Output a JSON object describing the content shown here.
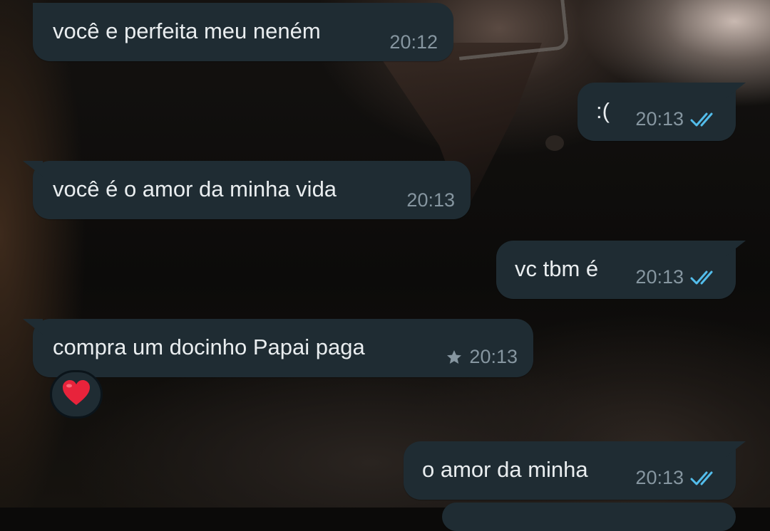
{
  "chat": {
    "messages": [
      {
        "direction": "incoming",
        "text": "você e perfeita meu neném",
        "time": "20:12"
      },
      {
        "direction": "outgoing",
        "text": ":(",
        "time": "20:13",
        "status": "read"
      },
      {
        "direction": "incoming",
        "text": "você é o amor da minha vida",
        "time": "20:13"
      },
      {
        "direction": "outgoing",
        "text": "vc tbm é",
        "time": "20:13",
        "status": "read"
      },
      {
        "direction": "incoming",
        "text": "compra um docinho Papai paga",
        "time": "20:13",
        "starred": true,
        "reaction": "heart-emoji"
      },
      {
        "direction": "outgoing",
        "text": "o amor da minha",
        "time": "20:13",
        "status": "read"
      }
    ]
  },
  "colors": {
    "bubble_bg": "#1f2c33",
    "text": "#e9edef",
    "meta_text": "#8696a0",
    "read_ticks": "#53bdeb",
    "heart": "#e8233b"
  }
}
